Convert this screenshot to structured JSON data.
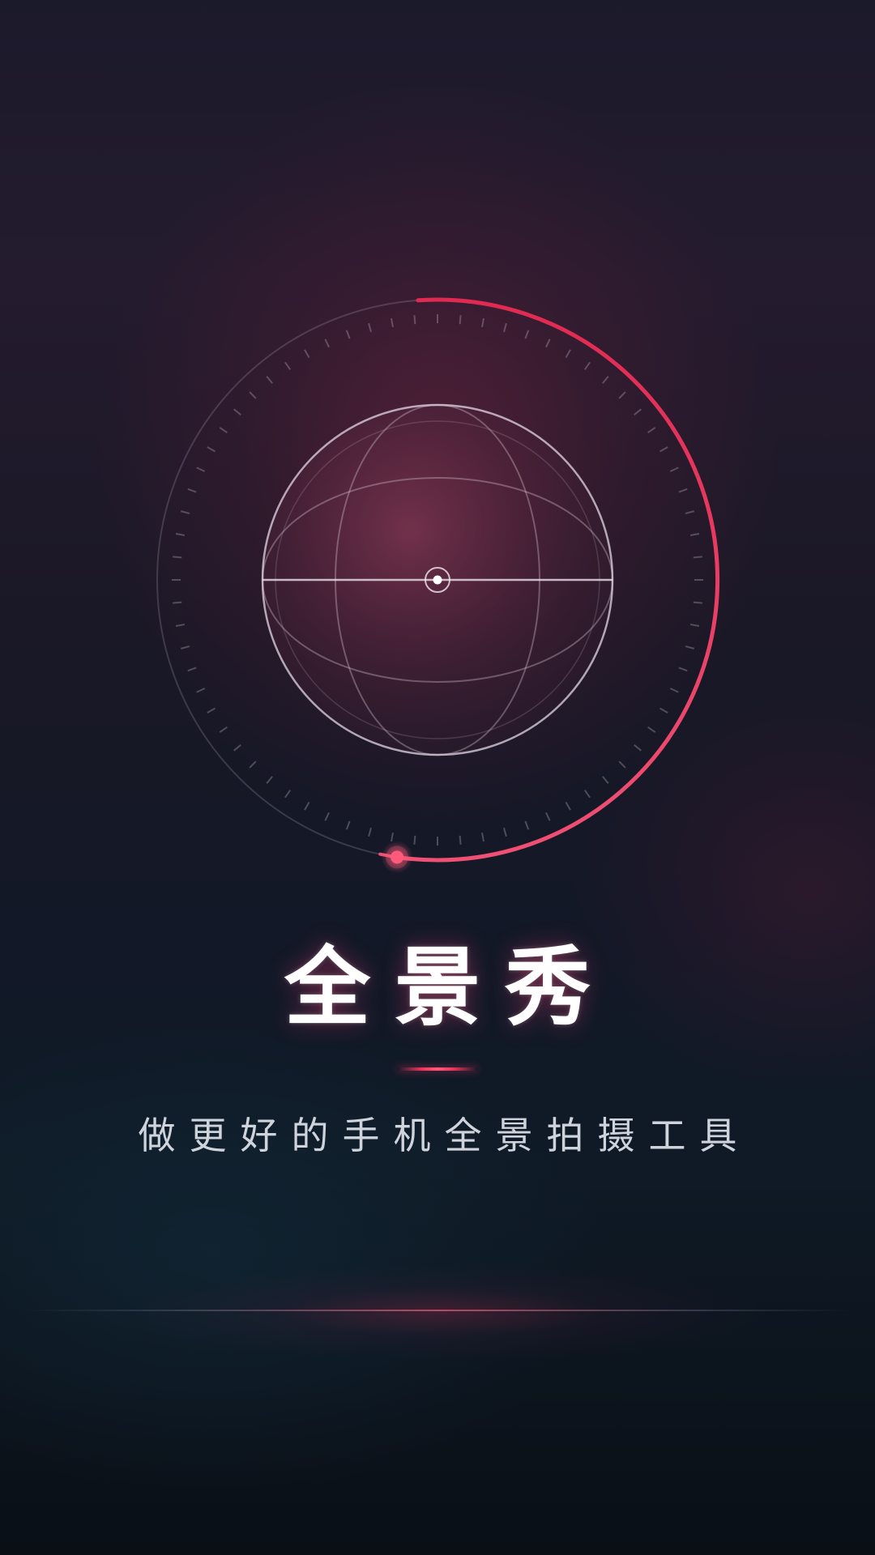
{
  "app": {
    "title": "全景秀",
    "tagline": "做更好的手机全景拍摄工具"
  },
  "progress": {
    "fraction": 0.53,
    "unit": "fraction of dial completed"
  },
  "icons": [
    "globe-wireframe-icon",
    "center-target-icon",
    "progress-handle-icon"
  ],
  "colors": {
    "accent": "#e8355f",
    "accent_light": "#ff6b8b",
    "background_top": "#1b1a2b",
    "background_bottom": "#0a0f16",
    "text_primary": "#ffffff",
    "text_secondary": "#cfd3dc"
  }
}
